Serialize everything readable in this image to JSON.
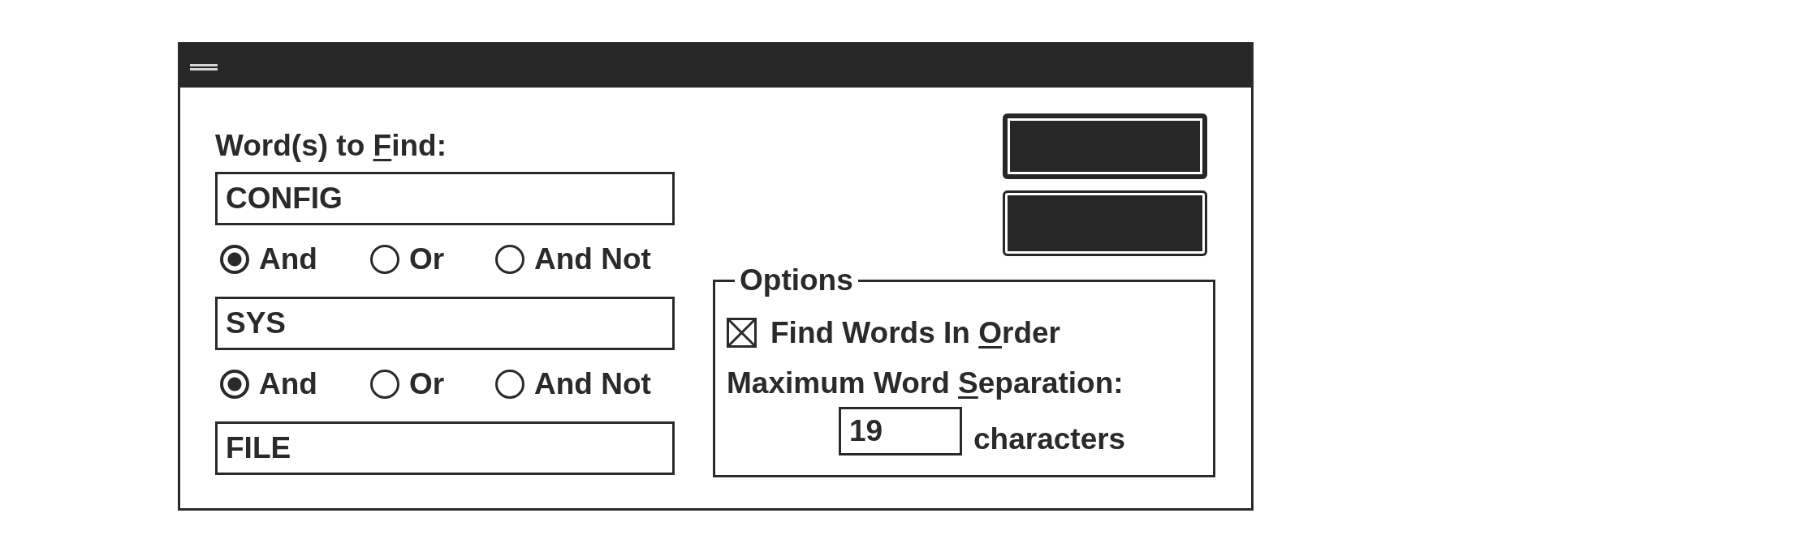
{
  "search": {
    "label": {
      "before": "Word(s) to ",
      "key": "F",
      "after": "ind:"
    },
    "terms": [
      "CONFIG",
      "SYS",
      "FILE"
    ],
    "operators": [
      {
        "options": [
          {
            "label": "And",
            "selected": true
          },
          {
            "label": "Or",
            "selected": false
          },
          {
            "label": "And Not",
            "selected": false
          }
        ]
      },
      {
        "options": [
          {
            "label": "And",
            "selected": true
          },
          {
            "label": "Or",
            "selected": false
          },
          {
            "label": "And Not",
            "selected": false
          }
        ]
      }
    ]
  },
  "buttons": [
    {
      "default": true
    },
    {
      "default": false
    }
  ],
  "options": {
    "title": "Options",
    "find_in_order": {
      "label": {
        "before": "Find Words In ",
        "key": "O",
        "after": "rder"
      },
      "checked": true
    },
    "max_separation": {
      "label": {
        "before": "Maximum Word ",
        "key": "S",
        "after": "eparation:"
      },
      "value": "19",
      "unit": "characters"
    }
  }
}
